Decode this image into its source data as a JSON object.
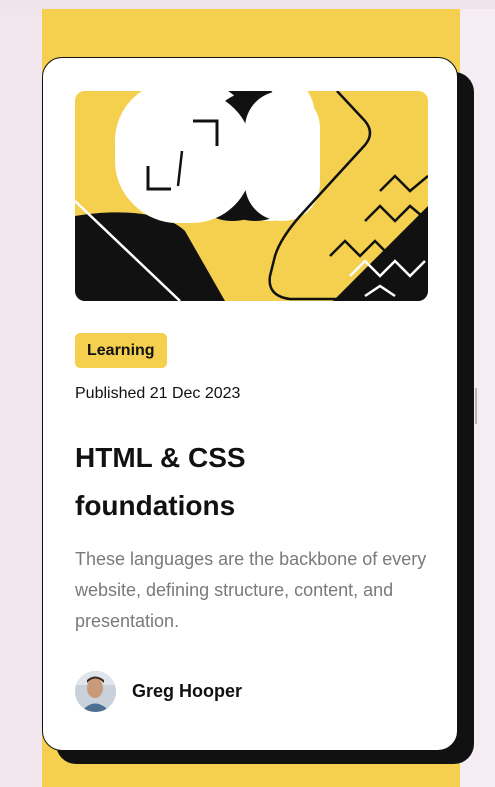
{
  "card": {
    "category": "Learning",
    "published": "Published 21 Dec 2023",
    "title": "HTML & CSS foundations",
    "description": "These languages are the backbone of every website, defining structure, content, and presentation.",
    "author": "Greg Hooper"
  },
  "colors": {
    "accent": "#f4d04e",
    "ink": "#111111",
    "muted": "#7a7a7a",
    "page_bg": "#f2e6ee"
  },
  "icons": {
    "hero": "abstract-illustration",
    "avatar": "author-avatar",
    "scroll": "scroll-handle-icon"
  }
}
